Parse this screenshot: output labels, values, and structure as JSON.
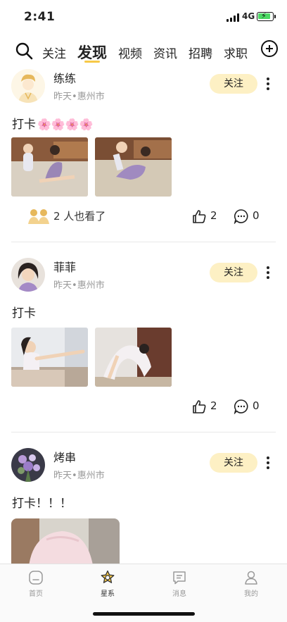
{
  "status": {
    "time": "2:41",
    "network": "4G"
  },
  "header": {
    "tabs": [
      {
        "label": "关注"
      },
      {
        "label": "发现"
      },
      {
        "label": "视频"
      },
      {
        "label": "资讯"
      },
      {
        "label": "招聘"
      },
      {
        "label": "求职"
      }
    ],
    "active_tab": "发现"
  },
  "posts": [
    {
      "username": "练练",
      "time": "昨天",
      "location": "惠州市",
      "follow_label": "关注",
      "text": "打卡",
      "emoji": "🌸🌸🌸🌸",
      "seen_text": "2 人也看了",
      "likes": "2",
      "comments": "0"
    },
    {
      "username": "菲菲",
      "time": "昨天",
      "location": "惠州市",
      "follow_label": "关注",
      "text": "打卡",
      "likes": "2",
      "comments": "0"
    },
    {
      "username": "烤串",
      "time": "昨天",
      "location": "惠州市",
      "follow_label": "关注",
      "text": "打卡！！！"
    }
  ],
  "meta_separator": "•",
  "tabbar": {
    "items": [
      {
        "label": "首页",
        "icon": "home-icon"
      },
      {
        "label": "星系",
        "icon": "galaxy-icon"
      },
      {
        "label": "消息",
        "icon": "message-icon"
      },
      {
        "label": "我的",
        "icon": "profile-icon"
      }
    ],
    "active": "星系"
  },
  "colors": {
    "accent": "#f7c948",
    "follow_bg": "#fdf0c4"
  }
}
